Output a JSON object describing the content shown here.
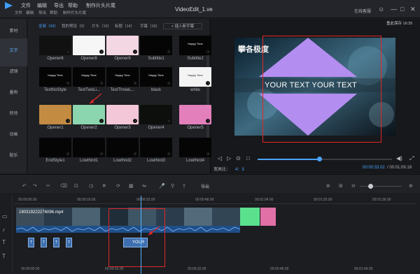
{
  "window": {
    "title": "VideoEdit_1.ve",
    "menu_top": [
      "文件",
      "编辑",
      "导出",
      "帮助",
      "制作片头片尾"
    ],
    "menu_sub": [
      "文件",
      "编辑",
      "导出",
      "帮助",
      "制作片头片尾"
    ],
    "help_link": "在线客服",
    "controls": [
      "☺",
      "—",
      "□",
      "✕"
    ]
  },
  "left_nav": {
    "items": [
      {
        "label": "素材"
      },
      {
        "label": "文字"
      },
      {
        "label": "滤镜"
      },
      {
        "label": "叠附"
      },
      {
        "label": "转场"
      },
      {
        "label": "动画"
      },
      {
        "label": "配乐"
      }
    ],
    "active_index": 1
  },
  "media_panel": {
    "tabs": [
      "全部（43）",
      "我的预设（0）",
      "片头（10）",
      "标题（14）",
      "字幕（19）"
    ],
    "active_tab": 0,
    "insert_button": "插入新字幕",
    "thumbnails": [
      {
        "label": "Opener6",
        "bg": "#111111",
        "text": ""
      },
      {
        "label": "Opener8",
        "bg": "#f6f6f6",
        "text": ""
      },
      {
        "label": "Opener9",
        "bg": "#f3d7e3",
        "text": ""
      },
      {
        "label": "Subtitle1",
        "bg": "#050505",
        "text": ""
      },
      {
        "label": "Subtitle2",
        "bg": "#050505",
        "text": "Happy Time"
      },
      {
        "label": "TextNoStyle",
        "bg": "#050505",
        "text": "Happy Time"
      },
      {
        "label": "TextTwoLi...",
        "bg": "#050505",
        "text": "Happy Time"
      },
      {
        "label": "TextThreeL...",
        "bg": "#050505",
        "text": "Happy Time"
      },
      {
        "label": "black",
        "bg": "#050505",
        "text": "Happy Time"
      },
      {
        "label": "white",
        "bg": "#f4f4f4",
        "text": "Happy Time"
      },
      {
        "label": "Opener1",
        "bg": "#c38b42",
        "text": ""
      },
      {
        "label": "Opener2",
        "bg": "#8bd6ae",
        "text": ""
      },
      {
        "label": "Opener3",
        "bg": "#f4c7d8",
        "text": ""
      },
      {
        "label": "Opener4",
        "bg": "#0d0f0c",
        "text": ""
      },
      {
        "label": "Opener5",
        "bg": "#e37fbb",
        "text": ""
      },
      {
        "label": "EndStyle1",
        "bg": "#050505",
        "text": ""
      },
      {
        "label": "Lowthird1",
        "bg": "#050505",
        "text": ""
      },
      {
        "label": "Lowthrid2",
        "bg": "#050505",
        "text": ""
      },
      {
        "label": "Lowthird3",
        "bg": "#050505",
        "text": ""
      },
      {
        "label": "Lowthird4",
        "bg": "#050505",
        "text": ""
      }
    ]
  },
  "preview": {
    "resolution_badge": "重此保存 16:35",
    "overlay_title": "攀各极度",
    "overlay_text": "YOUR TEXT YOUR TEXT",
    "aspect_label": "宽高比：",
    "aspect_value": "4：3",
    "time_current": "00:00:33.02",
    "time_total": "00:01:09.18"
  },
  "timeline": {
    "export_label": "导出",
    "ruler": [
      "00:00:00.00",
      "00:00:16.00",
      "00:00:32.00",
      "00:00:48.00",
      "00:01:04.00",
      "00:01:20.00",
      "00:01:36.00"
    ],
    "clip_label": "190319222276096.mp4",
    "text_clips": [
      "T",
      "T",
      "T",
      "T"
    ],
    "your_clip": "YOUR",
    "bottom_ruler": [
      "00:00:00.00",
      "00:00:16.00",
      "00:00:32.00",
      "00:00:48.00",
      "00:01:04.00"
    ]
  },
  "colors": {
    "accent": "#4aa3ff",
    "highlight_box": "#e02828",
    "diamond": "#b48df0"
  }
}
